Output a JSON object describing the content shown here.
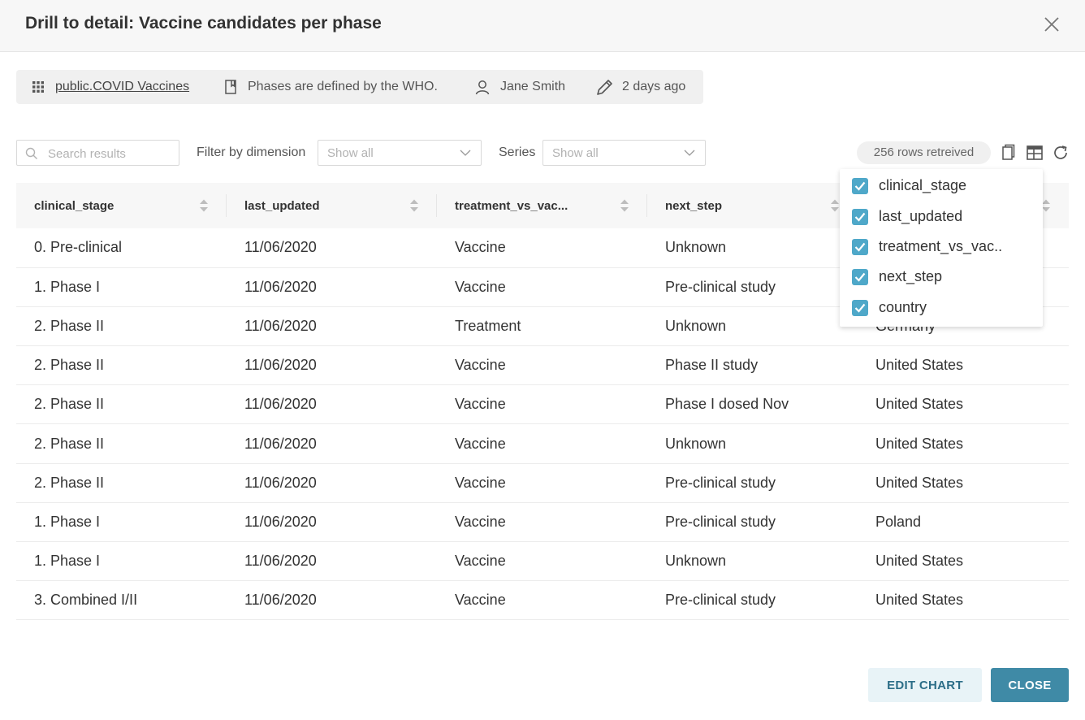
{
  "modal": {
    "title": "Drill to detail: Vaccine candidates per phase"
  },
  "meta": {
    "dataset": "public.COVID Vaccines",
    "description": "Phases are defined by the WHO.",
    "owner": "Jane Smith",
    "modified": "2 days ago"
  },
  "toolbar": {
    "search_placeholder": "Search results",
    "filter_label": "Filter by dimension",
    "filter_value": "Show all",
    "series_label": "Series",
    "series_value": "Show all",
    "rows_badge": "256 rows retreived"
  },
  "table": {
    "columns": [
      "clinical_stage",
      "last_updated",
      "treatment_vs_vac...",
      "next_step",
      ""
    ],
    "rows": [
      [
        "0. Pre-clinical",
        "11/06/2020",
        "Vaccine",
        "Unknown",
        ""
      ],
      [
        "1. Phase I",
        "11/06/2020",
        "Vaccine",
        "Pre-clinical study",
        ""
      ],
      [
        "2. Phase II",
        "11/06/2020",
        "Treatment",
        "Unknown",
        "Germany"
      ],
      [
        "2. Phase II",
        "11/06/2020",
        "Vaccine",
        "Phase II study",
        "United States"
      ],
      [
        "2. Phase II",
        "11/06/2020",
        "Vaccine",
        "Phase I dosed Nov",
        "United States"
      ],
      [
        "2. Phase II",
        "11/06/2020",
        "Vaccine",
        "Unknown",
        "United States"
      ],
      [
        "2. Phase II",
        "11/06/2020",
        "Vaccine",
        "Pre-clinical study",
        "United States"
      ],
      [
        "1. Phase I",
        "11/06/2020",
        "Vaccine",
        "Pre-clinical study",
        "Poland"
      ],
      [
        "1. Phase I",
        "11/06/2020",
        "Vaccine",
        "Unknown",
        "United States"
      ],
      [
        "3. Combined I/II",
        "11/06/2020",
        "Vaccine",
        "Pre-clinical study",
        "United States"
      ]
    ]
  },
  "column_picker": {
    "options": [
      {
        "label": "clinical_stage",
        "checked": true
      },
      {
        "label": "last_updated",
        "checked": true
      },
      {
        "label": "treatment_vs_vac..",
        "checked": true
      },
      {
        "label": "next_step",
        "checked": true
      },
      {
        "label": "country",
        "checked": true
      }
    ]
  },
  "footer": {
    "edit_label": "EDIT CHART",
    "close_label": "CLOSE"
  },
  "icons": {
    "close": "close-icon",
    "dataset": "grid-icon",
    "description": "bookmark-icon",
    "owner": "user-icon",
    "modified": "pencil-icon",
    "copy": "copy-icon",
    "columns": "table-columns-icon",
    "refresh": "refresh-icon"
  },
  "colors": {
    "accent": "#3f8aa6",
    "checkbox": "#4fa8c9",
    "secondary_button_bg": "#e8f3f7"
  }
}
